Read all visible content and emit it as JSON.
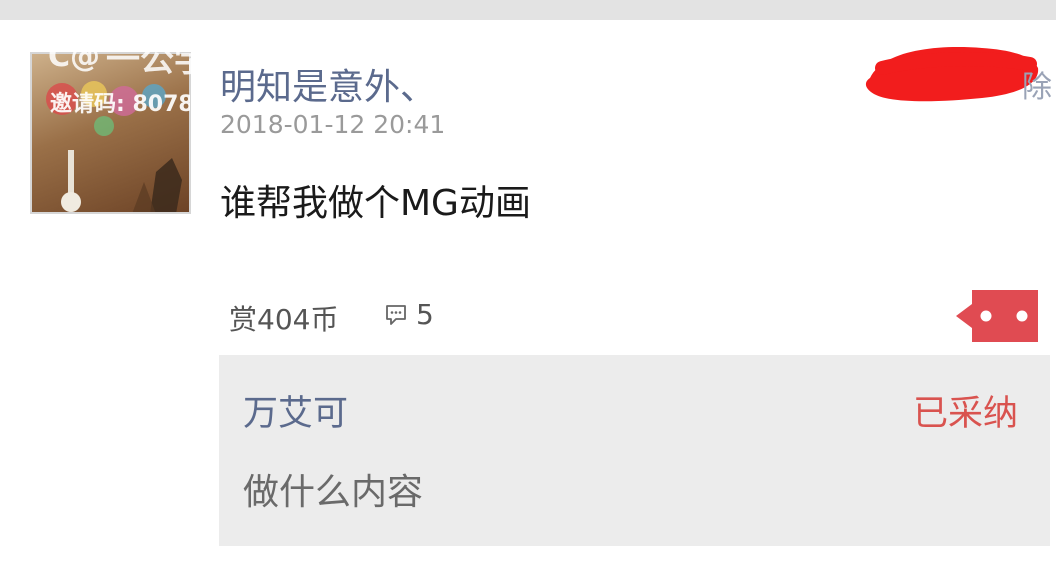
{
  "post": {
    "username": "明知是意外、",
    "timestamp": "2018-01-12 20:41",
    "content": "谁帮我做个MG动画",
    "reward": "赏404币",
    "comment_count": "5",
    "edge_text": "除"
  },
  "watermark": {
    "logo": "C@",
    "brand": "一公学霸",
    "invite_code": "邀请码: 8078"
  },
  "accepted_answer": {
    "username": "万艾可",
    "status": "已采纳",
    "content": "做什么内容"
  },
  "icons": {
    "comment": "comment-bubble-icon",
    "more": "more-dots-icon"
  },
  "colors": {
    "username": "#5b6a8d",
    "adopted": "#d9534f",
    "more_button": "#e04b52",
    "redaction": "#f21d1d",
    "answer_bg": "#ececec"
  }
}
